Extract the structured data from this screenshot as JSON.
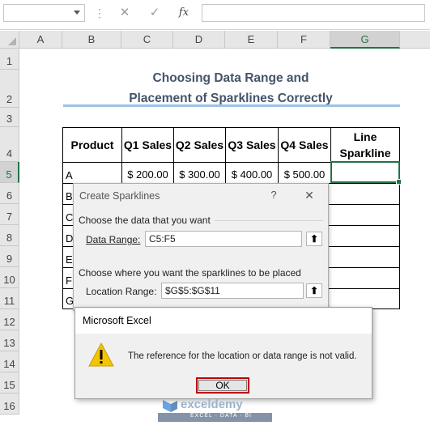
{
  "formula_bar": {
    "name_box": "",
    "dots": "⋮",
    "cancel": "✕",
    "enter": "✓",
    "fx": "fx",
    "formula": ""
  },
  "columns": [
    "A",
    "B",
    "C",
    "D",
    "E",
    "F",
    "G"
  ],
  "rows": [
    "1",
    "2",
    "3",
    "4",
    "5",
    "6",
    "7",
    "8",
    "9",
    "10",
    "11",
    "12",
    "13",
    "14",
    "15",
    "16"
  ],
  "sheet": {
    "title_line1": "Choosing Data Range and",
    "title_line2": "Placement of Sparklines Correctly",
    "headers": [
      "Product",
      "Q1 Sales",
      "Q2 Sales",
      "Q3 Sales",
      "Q4 Sales",
      "Line Sparkline"
    ],
    "rows": [
      {
        "product": "A",
        "q1": "$ 200.00",
        "q2": "$ 300.00",
        "q3": "$ 400.00",
        "q4": "$ 500.00"
      },
      {
        "product": "B"
      },
      {
        "product": "C"
      },
      {
        "product": "D"
      },
      {
        "product": "E"
      },
      {
        "product": "F"
      },
      {
        "product": "G"
      }
    ]
  },
  "create_sparklines": {
    "title": "Create Sparklines",
    "help": "?",
    "close": "✕",
    "section1": "Choose the data that you want",
    "data_range_label": "Data Range:",
    "data_range_value": "C5:F5",
    "section2": "Choose where you want the sparklines to be placed",
    "location_range_label": "Location Range:",
    "location_range_value": "$G$5:$G$11",
    "collapse": "⬆"
  },
  "message": {
    "title": "Microsoft Excel",
    "icon": "warning-icon",
    "text": "The reference for the location or data range is not valid.",
    "ok": "OK"
  },
  "watermark": {
    "brand": "exceldemy",
    "tagline": "EXCEL · DATA · BI"
  },
  "colors": {
    "excel_green": "#217346",
    "title_text": "#44546a",
    "ok_border": "#c00000"
  }
}
